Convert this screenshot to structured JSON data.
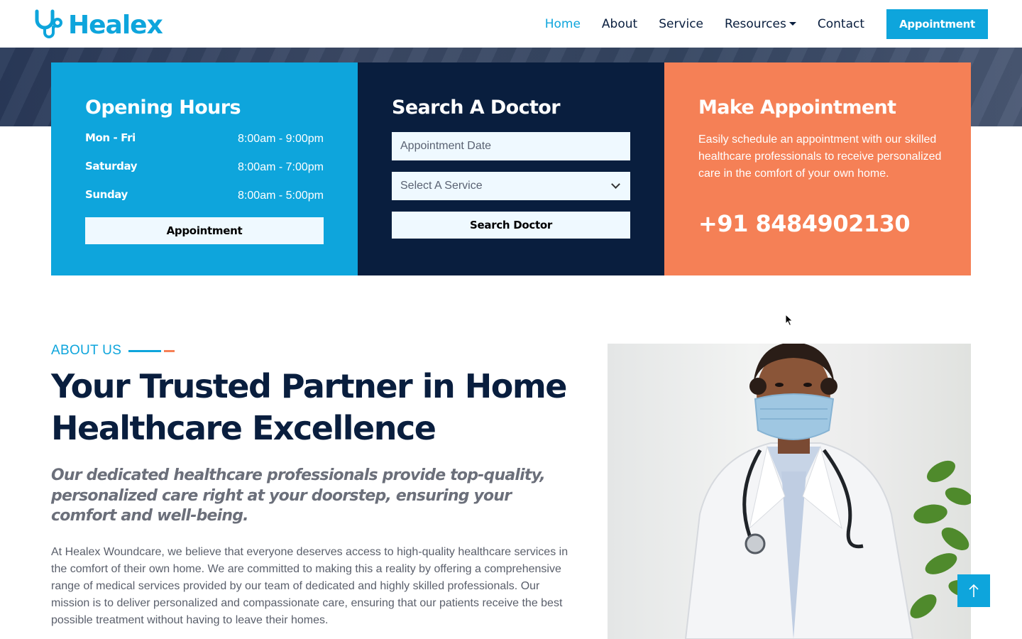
{
  "brand": {
    "name": "Healex",
    "color": "#0ea5dc",
    "icon": "stethoscope-icon"
  },
  "nav": {
    "items": [
      {
        "label": "Home",
        "active": true
      },
      {
        "label": "About",
        "active": false
      },
      {
        "label": "Service",
        "active": false
      },
      {
        "label": "Resources",
        "active": false,
        "dropdown": true
      },
      {
        "label": "Contact",
        "active": false
      }
    ],
    "cta_label": "Appointment"
  },
  "panels": {
    "hours": {
      "title": "Opening Hours",
      "rows": [
        {
          "day": "Mon - Fri",
          "time": "8:00am - 9:00pm"
        },
        {
          "day": "Saturday",
          "time": "8:00am - 7:00pm"
        },
        {
          "day": "Sunday",
          "time": "8:00am - 5:00pm"
        }
      ],
      "button_label": "Appointment",
      "color": "#0ea5dc"
    },
    "search": {
      "title": "Search A Doctor",
      "date_placeholder": "Appointment Date",
      "service_selected": "Select A Service",
      "button_label": "Search Doctor",
      "color": "#091e3e"
    },
    "appointment": {
      "title": "Make Appointment",
      "text": "Easily schedule an appointment with our skilled healthcare professionals to receive personalized care in the comfort of your own home.",
      "phone": "+91 8484902130",
      "color": "#f58056"
    }
  },
  "about": {
    "label": "ABOUT US",
    "title": "Your Trusted Partner in Home Healthcare Excellence",
    "lead": "Our dedicated healthcare professionals provide top-quality, personalized care right at your doorstep, ensuring your comfort and well-being.",
    "body": "At Healex Woundcare, we believe that everyone deserves access to high-quality healthcare services in the comfort of their own home. We are committed to making this a reality by offering a comprehensive range of medical services provided by our team of dedicated and highly skilled professionals. Our mission is to deliver personalized and compassionate care, ensuring that our patients receive the best possible treatment without having to leave their homes."
  },
  "icons": {
    "back_to_top": "arrow-up-icon",
    "select": "chevron-down-icon"
  }
}
